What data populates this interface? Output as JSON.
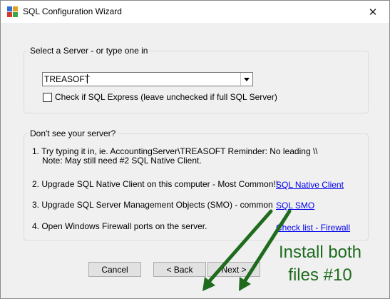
{
  "window": {
    "title": "SQL Configuration Wizard"
  },
  "server_group": {
    "title": "Select a Server - or type one in",
    "server_value": "TREASOFT",
    "express_checked": false,
    "express_label": "Check if SQL Express (leave unchecked if full SQL Server)"
  },
  "help_group": {
    "title": "Don't see your server?",
    "step1_line1": "1. Try typing it in, ie. AccountingServer\\TREASOFT  Reminder: No leading \\\\",
    "step1_line2": "Note: May still need #2 SQL Native Client.",
    "step2": "2. Upgrade SQL Native Client on this computer - Most Common!!",
    "step2_link": "SQL Native Client",
    "step3": "3. Upgrade SQL Server Management Objects (SMO) - common",
    "step3_link": "SQL SMO",
    "step4": "4. Open Windows Firewall ports on the server.",
    "step4_link": "Check list - Firewall"
  },
  "buttons": {
    "cancel": "Cancel",
    "back": "< Back",
    "next": "Next >"
  },
  "annotation": {
    "line1": "Install both",
    "line2": "files #10",
    "color": "#1e6b1e"
  }
}
